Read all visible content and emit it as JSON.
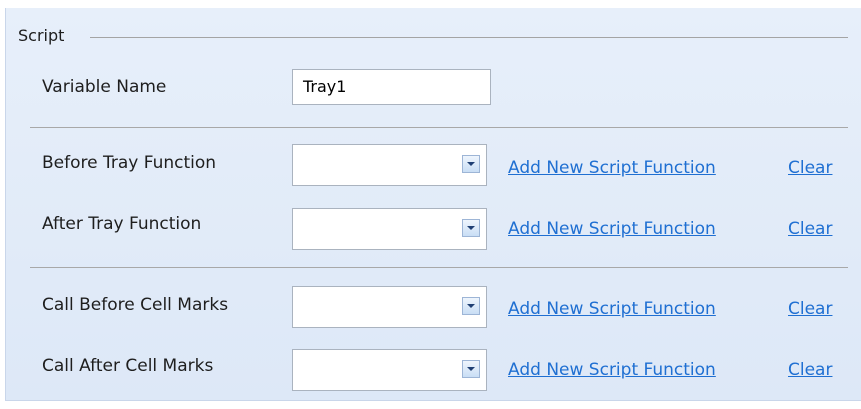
{
  "group": {
    "title": "Script"
  },
  "variable": {
    "label": "Variable Name",
    "value": "Tray1"
  },
  "rows": [
    {
      "label": "Before Tray Function",
      "selected": "",
      "add_link": "Add New Script Function",
      "clear_link": "Clear"
    },
    {
      "label": "After Tray Function",
      "selected": "",
      "add_link": "Add New Script Function",
      "clear_link": "Clear"
    },
    {
      "label": "Call Before Cell Marks",
      "selected": "",
      "add_link": "Add New Script Function",
      "clear_link": "Clear"
    },
    {
      "label": "Call After Cell Marks",
      "selected": "",
      "add_link": "Add New Script Function",
      "clear_link": "Clear"
    }
  ],
  "icons": {
    "dropdown": "chevron-down-icon"
  },
  "colors": {
    "panel_background": "#e3ecf9",
    "link": "#1f6fd2"
  }
}
